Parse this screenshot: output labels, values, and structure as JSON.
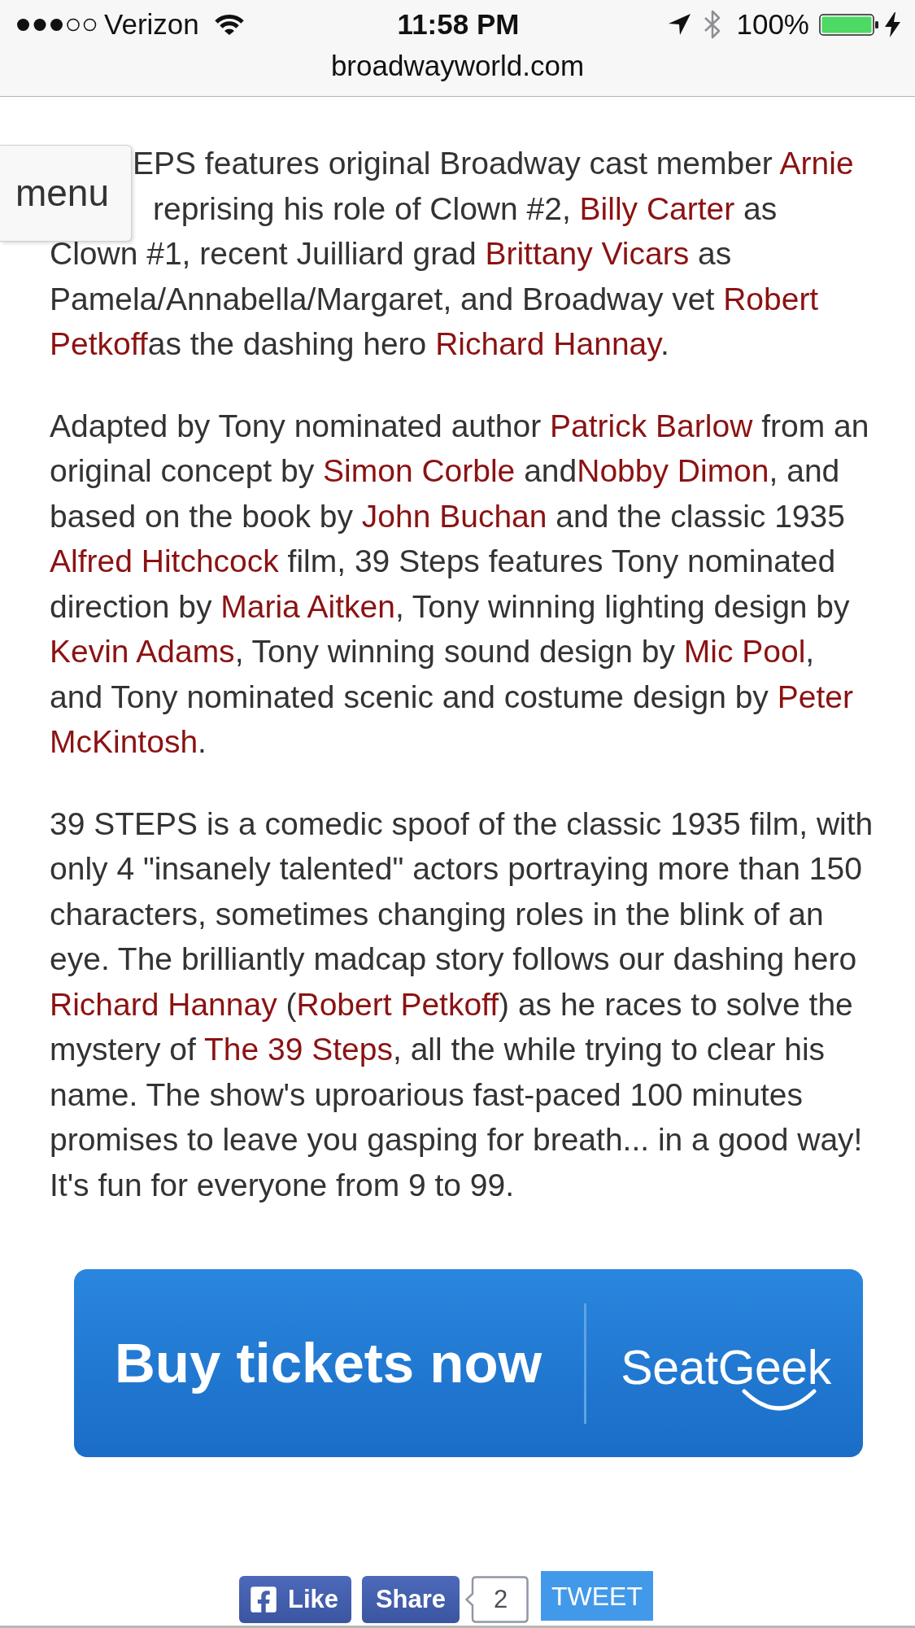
{
  "status_bar": {
    "carrier": "Verizon",
    "time": "11:58 PM",
    "battery": "100%"
  },
  "address_bar": {
    "url": "broadwayworld.com"
  },
  "menu_button": {
    "label": "menu"
  },
  "article": {
    "covered_paragraph": {
      "beside_menu": [
        {
          "kind": "text",
          "text": "EPS features original Broadway cast member "
        },
        {
          "kind": "link",
          "text": "Arnie"
        },
        {
          "kind": "text",
          "text": " reprising his role of Clown #2, "
        },
        {
          "kind": "link",
          "text": "Billy Carter"
        },
        {
          "kind": "text",
          "text": " as"
        }
      ],
      "below_menu": [
        {
          "kind": "text",
          "text": "Clown #1, recent Juilliard grad "
        },
        {
          "kind": "link",
          "text": "Brittany Vicars"
        },
        {
          "kind": "text",
          "text": " as Pamela/Annabella/Margaret, and Broadway vet "
        },
        {
          "kind": "link",
          "text": "Robert"
        },
        {
          "kind": "space"
        },
        {
          "kind": "link",
          "text": "Petkoff"
        },
        {
          "kind": "text",
          "text": "as the dashing hero "
        },
        {
          "kind": "link",
          "text": "Richard Hannay"
        },
        {
          "kind": "text",
          "text": "."
        }
      ]
    },
    "paragraphs": [
      {
        "segments": [
          {
            "kind": "text",
            "text": "Adapted by Tony nominated author "
          },
          {
            "kind": "link",
            "text": "Patrick Barlow"
          },
          {
            "kind": "text",
            "text": " from an original concept by "
          },
          {
            "kind": "link",
            "text": "Simon Corble"
          },
          {
            "kind": "text",
            "text": " and"
          },
          {
            "kind": "link",
            "text": "Nobby Dimon"
          },
          {
            "kind": "text",
            "text": ", and based on the book by "
          },
          {
            "kind": "link",
            "text": "John Buchan"
          },
          {
            "kind": "text",
            "text": " and the classic 1935 "
          },
          {
            "kind": "link",
            "text": "Alfred Hitchcock"
          },
          {
            "kind": "text",
            "text": " film, 39 Steps features Tony nominated direction by "
          },
          {
            "kind": "link",
            "text": "Maria Aitken"
          },
          {
            "kind": "text",
            "text": ", Tony winning lighting design by "
          },
          {
            "kind": "link",
            "text": "Kevin Adams"
          },
          {
            "kind": "text",
            "text": ", Tony winning sound design by "
          },
          {
            "kind": "link",
            "text": "Mic Pool"
          },
          {
            "kind": "text",
            "text": ", and Tony nominated scenic and costume design by "
          },
          {
            "kind": "link",
            "text": "Peter"
          },
          {
            "kind": "space"
          },
          {
            "kind": "link",
            "text": "McKintosh"
          },
          {
            "kind": "text",
            "text": "."
          }
        ]
      },
      {
        "segments": [
          {
            "kind": "text",
            "text": "39 STEPS is a comedic spoof of the classic 1935 film, with only 4 \"insanely talented\" actors portraying more than 150 characters, sometimes changing roles in the blink of an eye. The brilliantly madcap story follows our dashing hero "
          },
          {
            "kind": "link",
            "text": "Richard Hannay"
          },
          {
            "kind": "text",
            "text": " ("
          },
          {
            "kind": "link",
            "text": "Robert Petkoff"
          },
          {
            "kind": "text",
            "text": ") as he races to solve the mystery of "
          },
          {
            "kind": "link",
            "text": "The 39 Steps"
          },
          {
            "kind": "text",
            "text": ", all the while trying to clear his name. The show's uproarious fast-paced 100 minutes promises to leave you gasping for breath... in a good way! It's fun for everyone from 9 to 99."
          }
        ]
      }
    ]
  },
  "ticket_banner": {
    "label": "Buy tickets now",
    "brand": "SeatGeek"
  },
  "social_bar": {
    "like": "Like",
    "share": "Share",
    "share_count": "2",
    "tweet": "TWEET"
  }
}
